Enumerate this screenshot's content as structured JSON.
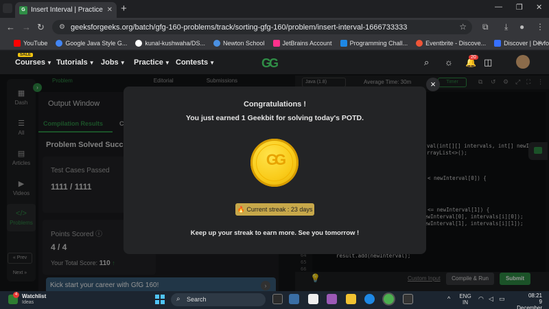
{
  "browser": {
    "tab_title": "Insert Interval | Practice | Geeksfo",
    "url": "geeksforgeeks.org/batch/gfg-160-problems/track/sorting-gfg-160/problem/insert-interval-1666733333",
    "bookmarks": [
      {
        "label": "YouTube",
        "color": "#ff0000"
      },
      {
        "label": "Google Java Style G...",
        "color": "#4285f4"
      },
      {
        "label": "kunal-kushwaha/DS...",
        "color": "#ffffff"
      },
      {
        "label": "Newton School",
        "color": "#4a90e2"
      },
      {
        "label": "JetBrains Account",
        "color": "#ff318c"
      },
      {
        "label": "Programming Chall...",
        "color": "#1e88e5"
      },
      {
        "label": "Eventbrite - Discove...",
        "color": "#f05537"
      },
      {
        "label": "Discover | Devfolio",
        "color": "#3770ff"
      }
    ]
  },
  "site": {
    "sale_badge": "SALE",
    "menus": [
      "Courses",
      "Tutorials",
      "Jobs",
      "Practice",
      "Contests"
    ],
    "logo": "GG",
    "notification_count": "20"
  },
  "problem_tabs": [
    "Problem",
    "Editorial",
    "Submissions"
  ],
  "sidebar": [
    "Dash",
    "All",
    "Articles",
    "Videos",
    "Problems"
  ],
  "sidebar_buttons": {
    "prev": "« Prev",
    "next": "Next »"
  },
  "output": {
    "window_title": "Output Window",
    "tab_results": "Compilation Results",
    "tab_c": "C",
    "solved": "Problem Solved Succes",
    "tests_label": "Test Cases Passed",
    "tests_value": "1111 / 1111",
    "points_label": "Points Scored",
    "points_value": "4 / 4",
    "total_label": "Your Total Score:",
    "total_value": "110",
    "promo": "Kick start your career with GfG 160!"
  },
  "editor": {
    "language": "Java (1.8)",
    "avg_time": "Average Time: 30m",
    "timer": "Timer",
    "custom_input": "Custom Input",
    "compile": "Compile & Run",
    "submit": "Submit",
    "lines": [
      {
        "n": "",
        "text": "val(int[][] intervals, int[] newInter"
      },
      {
        "n": "",
        "text": "rrayList<>();"
      },
      {
        "n": "",
        "text": "< newInterval[0]) {"
      },
      {
        "n": "",
        "text": "<= newInterval[1]) {"
      },
      {
        "n": "",
        "text": "ewInterval[0], intervals[i][0]);"
      },
      {
        "n": "",
        "text": "ewInterval[1], intervals[i][1]);"
      },
      {
        "n": "64",
        "text": "result.add(newInterval);"
      },
      {
        "n": "65",
        "text": ""
      },
      {
        "n": "66",
        "text": ""
      }
    ]
  },
  "modal": {
    "title": "Congratulations !",
    "subtitle": "You just earned 1 Geekbit for solving today's POTD.",
    "streak": "Current streak : 23 days",
    "footer": "Keep up your streak to earn more. See you tomorrow !",
    "close": "×"
  },
  "taskbar": {
    "watchlist_title": "Watchlist",
    "watchlist_sub": "Ideas",
    "watchlist_badge": "4",
    "search": "Search",
    "lang_top": "ENG",
    "lang_bottom": "IN",
    "time": "08:21",
    "date": "9 December"
  }
}
